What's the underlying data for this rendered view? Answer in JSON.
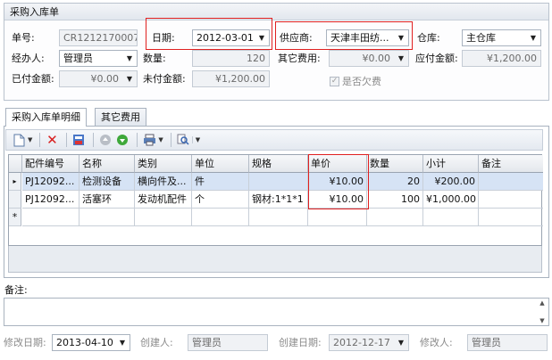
{
  "header": {
    "title": "采购入库单"
  },
  "form": {
    "order_no": {
      "label": "单号:",
      "value": "CR1212170007"
    },
    "date": {
      "label": "日期:",
      "value": "2012-03-01"
    },
    "supplier": {
      "label": "供应商:",
      "value": "天津丰田纺..."
    },
    "warehouse": {
      "label": "仓库:",
      "value": "主仓库"
    },
    "handler": {
      "label": "经办人:",
      "value": "管理员"
    },
    "quantity": {
      "label": "数量:",
      "value": "120"
    },
    "other_fee": {
      "label": "其它费用:",
      "value": "¥0.00"
    },
    "payable": {
      "label": "应付金额:",
      "value": "¥1,200.00"
    },
    "paid": {
      "label": "已付金额:",
      "value": "¥0.00"
    },
    "unpaid": {
      "label": "未付金额:",
      "value": "¥1,200.00"
    },
    "owing": {
      "label": "是否欠费",
      "checked": true
    }
  },
  "tabs": [
    {
      "label": "采购入库单明细",
      "active": true
    },
    {
      "label": "其它费用",
      "active": false
    }
  ],
  "toolbar": {
    "icons": [
      "new-document-icon",
      "delete-icon",
      "save-grid-icon",
      "move-up-icon",
      "move-down-icon",
      "print-icon",
      "search-icon"
    ]
  },
  "grid": {
    "columns": [
      "配件编号",
      "名称",
      "类别",
      "单位",
      "规格",
      "单价",
      "数量",
      "小计",
      "备注"
    ],
    "rows": [
      [
        "PJ12092...",
        "检测设备",
        "横向件及...",
        "件",
        "",
        "¥10.00",
        "20",
        "¥200.00",
        ""
      ],
      [
        "PJ12092...",
        "活塞环",
        "发动机配件",
        "个",
        "钢材:1*1*1",
        "¥10.00",
        "100",
        "¥1,000.00",
        ""
      ]
    ],
    "new_row_marker": "*",
    "current_row_marker": "▸"
  },
  "remarks": {
    "label": "备注:",
    "value": ""
  },
  "footer": {
    "modified_date": {
      "label": "修改日期:",
      "value": "2013-04-10"
    },
    "creator": {
      "label": "创建人:",
      "value": "管理员"
    },
    "created_date": {
      "label": "创建日期:",
      "value": "2012-12-17"
    },
    "modifier": {
      "label": "修改人:",
      "value": "管理员"
    }
  },
  "colors": {
    "highlight": "#e02020",
    "selection": "#d6e3f5",
    "border": "#a9b3bf"
  }
}
